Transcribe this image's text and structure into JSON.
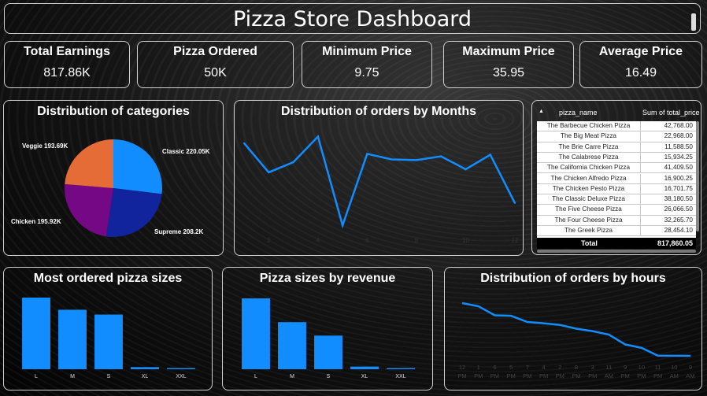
{
  "title": "Pizza Store Dashboard",
  "kpis": [
    {
      "label": "Total Earnings",
      "value": "817.86K"
    },
    {
      "label": "Pizza Ordered",
      "value": "50K"
    },
    {
      "label": "Minimum Price",
      "value": "9.75"
    },
    {
      "label": "Maximum Price",
      "value": "35.95"
    },
    {
      "label": "Average Price",
      "value": "16.49"
    }
  ],
  "panels": {
    "categories": "Distribution of categories",
    "months": "Distribution of orders by Months",
    "sizes": "Most ordered pizza sizes",
    "revenue": "Pizza sizes by revenue",
    "hours": "Distribution of orders by hours"
  },
  "table": {
    "headers": [
      "pizza_name",
      "Sum of total_price"
    ],
    "rows": [
      [
        "The Barbecue Chicken Pizza",
        "42,768.00"
      ],
      [
        "The Big Meat Pizza",
        "22,968.00"
      ],
      [
        "The Brie Carre Pizza",
        "11,588.50"
      ],
      [
        "The Calabrese Pizza",
        "15,934.25"
      ],
      [
        "The California Chicken Pizza",
        "41,409.50"
      ],
      [
        "The Chicken Alfredo Pizza",
        "16,900.25"
      ],
      [
        "The Chicken Pesto Pizza",
        "16,701.75"
      ],
      [
        "The Classic Deluxe Pizza",
        "38,180.50"
      ],
      [
        "The Five Cheese Pizza",
        "26,066.50"
      ],
      [
        "The Four Cheese Pizza",
        "32,265.70"
      ],
      [
        "The Greek Pizza",
        "28,454.10"
      ]
    ],
    "total_label": "Total",
    "total_value": "817,860.05"
  },
  "chart_data": [
    {
      "type": "pie",
      "title": "Distribution of categories",
      "labels": [
        "Classic",
        "Supreme",
        "Chicken",
        "Veggie"
      ],
      "values": [
        220.05,
        208.2,
        195.92,
        193.69
      ],
      "data_labels": [
        "Classic 220.05K",
        "Supreme 208.2K",
        "Chicken 195.92K",
        "Veggie 193.69K"
      ],
      "colors": [
        "#118dff",
        "#12239e",
        "#750985",
        "#e66c37"
      ]
    },
    {
      "type": "line",
      "title": "Distribution of orders by Months",
      "x": [
        1,
        2,
        3,
        4,
        5,
        6,
        7,
        8,
        9,
        10,
        11,
        12
      ],
      "tick_labels": [
        "2",
        "4",
        "6",
        "8",
        "10",
        "12"
      ],
      "values": [
        4232,
        3892,
        4010,
        4308,
        3275,
        4107,
        4043,
        4035,
        4079,
        3928,
        4097,
        3535
      ],
      "ylim": [
        3150,
        4450
      ],
      "color": "#118dff"
    },
    {
      "type": "bar",
      "title": "Most ordered pizza sizes",
      "categories": [
        "L",
        "M",
        "S",
        "XL",
        "XXL"
      ],
      "values": [
        18526,
        15385,
        14137,
        544,
        28
      ],
      "color": "#118dff"
    },
    {
      "type": "bar",
      "title": "Pizza sizes by revenue",
      "categories": [
        "L",
        "M",
        "S",
        "XL",
        "XXL"
      ],
      "values": [
        375318,
        249382,
        178076,
        14076,
        1007
      ],
      "color": "#118dff"
    },
    {
      "type": "line",
      "title": "Distribution of orders by hours",
      "categories": [
        "12 PM",
        "1 PM",
        "6 PM",
        "5 PM",
        "7 PM",
        "4 PM",
        "2 PM",
        "8 PM",
        "3 PM",
        "11 AM",
        "9 PM",
        "10 PM",
        "11 PM",
        "10 AM",
        "9 AM"
      ],
      "values": [
        6776,
        6363,
        5211,
        5143,
        4350,
        4185,
        3972,
        3487,
        3170,
        2728,
        1464,
        1024,
        28,
        18,
        4
      ],
      "color": "#118dff"
    }
  ]
}
